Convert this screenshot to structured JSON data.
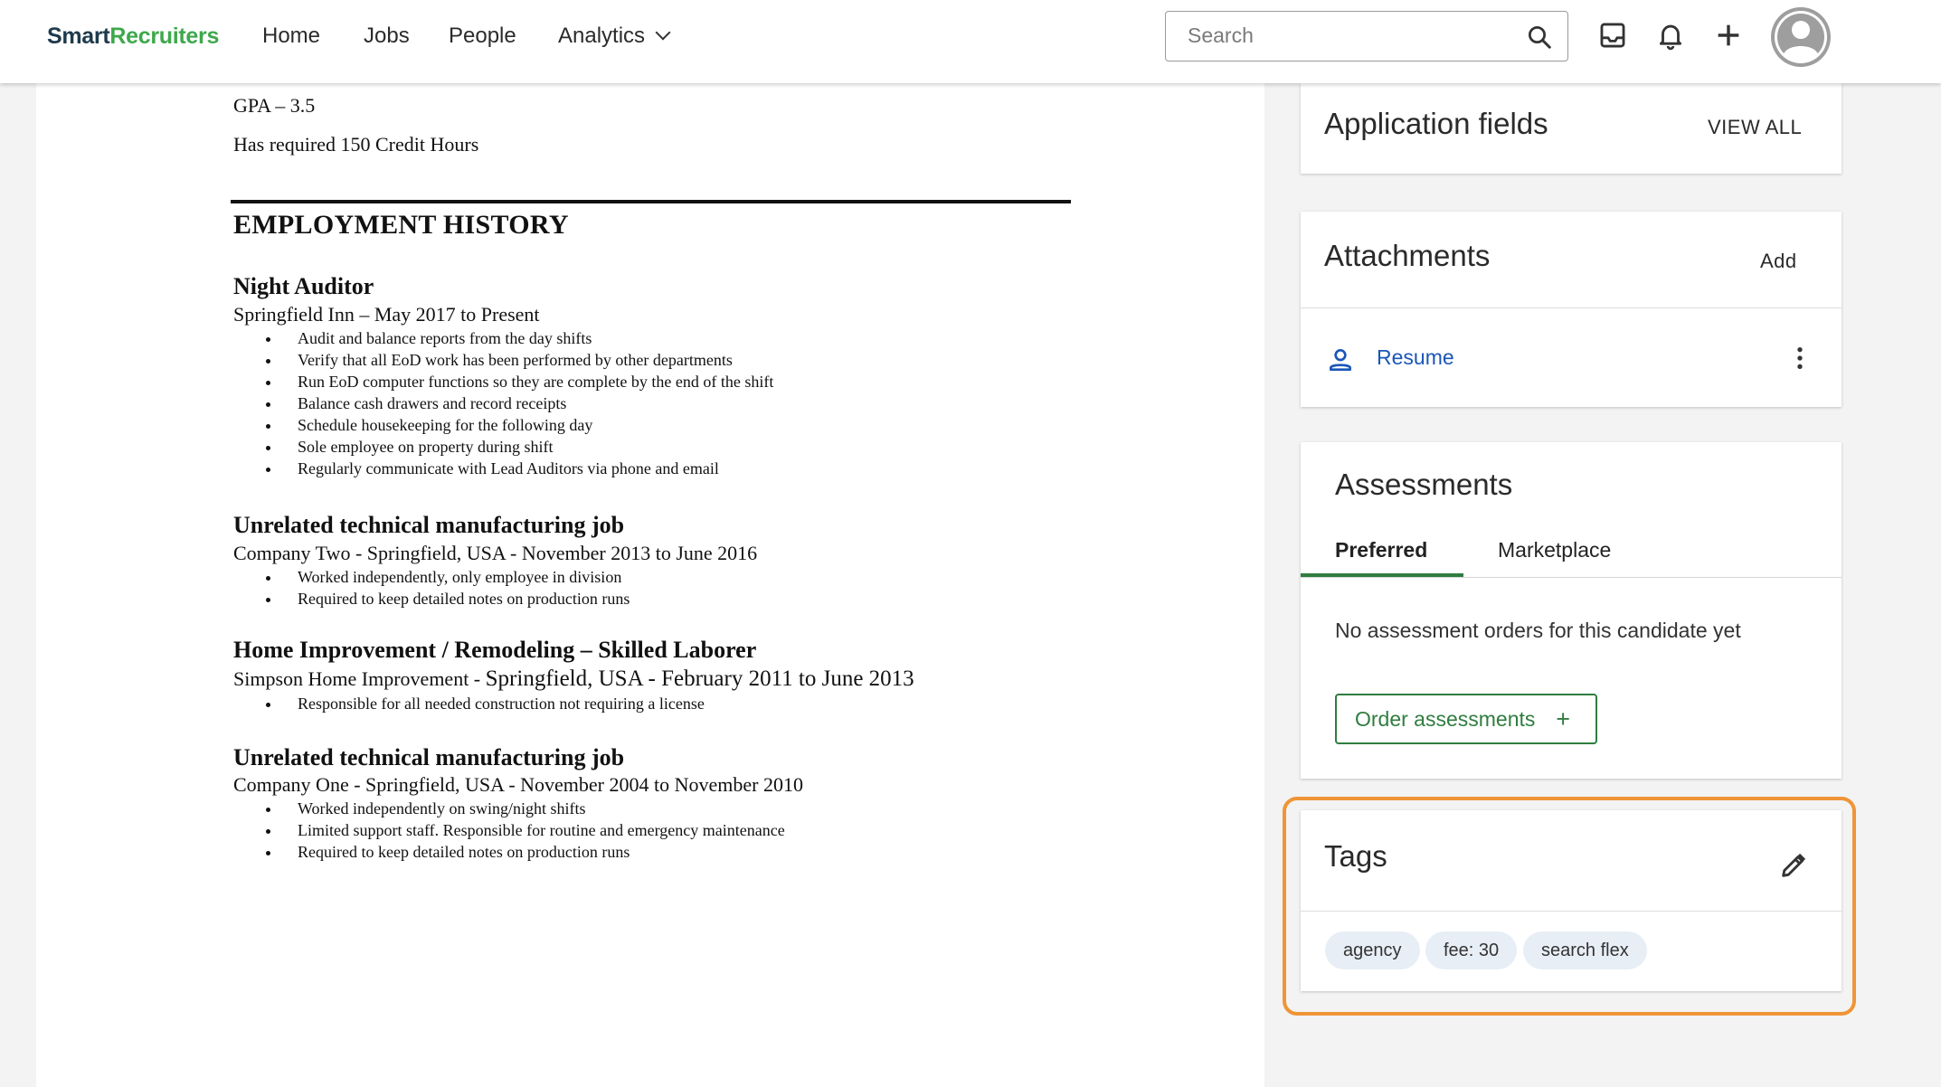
{
  "header": {
    "logo_part1": "Smart",
    "logo_part2": "Recruiters",
    "nav": {
      "home": "Home",
      "jobs": "Jobs",
      "people": "People",
      "analytics": "Analytics"
    },
    "search_placeholder": "Search",
    "icons": [
      "search-icon",
      "inbox-icon",
      "bell-icon",
      "plus-icon",
      "avatar-icon"
    ]
  },
  "resume": {
    "gpa": "GPA – 3.5",
    "credits": "Has required 150 Credit Hours",
    "section_title": "EMPLOYMENT HISTORY",
    "jobs": [
      {
        "title": "Night Auditor",
        "company": "Springfield Inn – May 2017 to Present",
        "bullets": [
          "Audit and balance reports from the day shifts",
          "Verify that all EoD work has been performed by other departments",
          "Run EoD computer functions so they are complete by the end of the shift",
          "Balance cash drawers and record receipts",
          "Schedule housekeeping for the following day",
          "Sole employee on property during shift",
          "Regularly communicate with Lead Auditors via phone and email"
        ]
      },
      {
        "title": "Unrelated technical manufacturing job",
        "company": "Company Two - Springfield, USA - November 2013 to June 2016",
        "bullets": [
          "Worked independently, only employee in division",
          "Required to keep detailed notes on production runs"
        ]
      },
      {
        "title": "Home Improvement / Remodeling – Skilled Laborer",
        "company_a": "Simpson Home Improvement - ",
        "company_b": "Springfield, USA - February 2011 to June 2013",
        "bullets": [
          "Responsible for all needed construction not requiring a license"
        ]
      },
      {
        "title": "Unrelated technical manufacturing job",
        "company": "Company One - Springfield, USA - November 2004 to November 2010",
        "bullets": [
          "Worked independently on swing/night shifts",
          "Limited support staff.  Responsible for routine and emergency maintenance",
          "Required to keep detailed notes on production runs"
        ]
      }
    ]
  },
  "sidebar": {
    "application_fields": {
      "title": "Application fields",
      "action": "VIEW ALL"
    },
    "attachments": {
      "title": "Attachments",
      "action": "Add",
      "file_label": "Resume"
    },
    "assessments": {
      "title": "Assessments",
      "tabs": [
        "Preferred",
        "Marketplace"
      ],
      "active_tab": "Preferred",
      "empty_message": "No assessment orders for this candidate yet",
      "order_button": "Order assessments",
      "order_button_icon": "+"
    },
    "tags": {
      "title": "Tags",
      "items": [
        "agency",
        "fee: 30",
        "search flex"
      ]
    }
  },
  "colors": {
    "brand_dark": "#1e3a4c",
    "brand_green": "#3ea84b",
    "accent_green": "#2f7d3f",
    "link_blue": "#1a56b8",
    "highlight_orange": "#ef9537",
    "chip_bg": "#e8eef6"
  }
}
